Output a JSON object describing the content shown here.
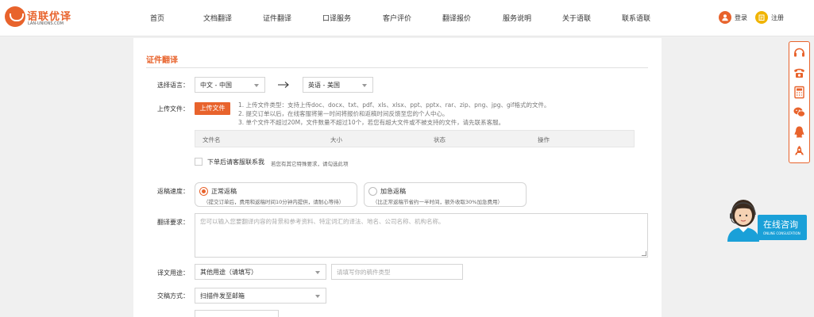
{
  "brand": {
    "name": "语联优译",
    "domain": "LAN-UNIONS.COM",
    "accent": "#e8632c"
  },
  "nav": [
    "首页",
    "文档翻译",
    "证件翻译",
    "口译服务",
    "客户评价",
    "翻译报价",
    "服务说明",
    "关于语联",
    "联系语联"
  ],
  "auth": {
    "login": "登录",
    "register": "注册"
  },
  "form": {
    "title": "证件翻译",
    "language": {
      "label": "选择语言：",
      "source": "中文 - 中国",
      "target": "英语 - 美国"
    },
    "upload": {
      "label": "上传文件：",
      "button": "上传文件",
      "tips": [
        "1. 上传文件类型：支持上传doc、docx、txt、pdf、xls、xlsx、ppt、pptx、rar、zip、png、jpg、gif格式的文件。",
        "2. 提交订单以后，在线客服将第一时间将报价和返稿时间反馈至您的个人中心。",
        "3. 单个文件不超过20M，文件数量不超过10个，若您有超大文件或不被支持的文件，请先联系客服。"
      ],
      "columns": [
        "文件名",
        "大小",
        "状态",
        "操作"
      ]
    },
    "contact": {
      "label": "下单后请客服联系我",
      "note": "若您有其它特殊要求，请勾选此项"
    },
    "speed": {
      "label": "返稿速度：",
      "normal": {
        "title": "正常返稿",
        "desc": "（提交订单后，费用和返稿时间10分钟内提供，请耐心等待）"
      },
      "urgent": {
        "title": "加急返稿",
        "desc": "（比正常返稿节省约一半时间，额外收取30%加急费用）"
      }
    },
    "requirements": {
      "label": "翻译要求：",
      "placeholder": "您可以输入您要翻译内容的背景和参考资料、特定词汇的译法、地名、公司名称、机构名称。"
    },
    "purpose": {
      "label": "译文用途：",
      "value": "其他用途（请填写）",
      "placeholder": "请填写你的稿件类型"
    },
    "delivery": {
      "label": "交稿方式：",
      "value": "扫描件发至邮箱"
    }
  },
  "consult": {
    "title": "在线咨询",
    "subtitle": "ONLINE CONSULTATION"
  },
  "sidebar_icons": [
    "headset-icon",
    "phone-icon",
    "calculator-icon",
    "wechat-icon",
    "qq-icon",
    "rocket-icon"
  ]
}
